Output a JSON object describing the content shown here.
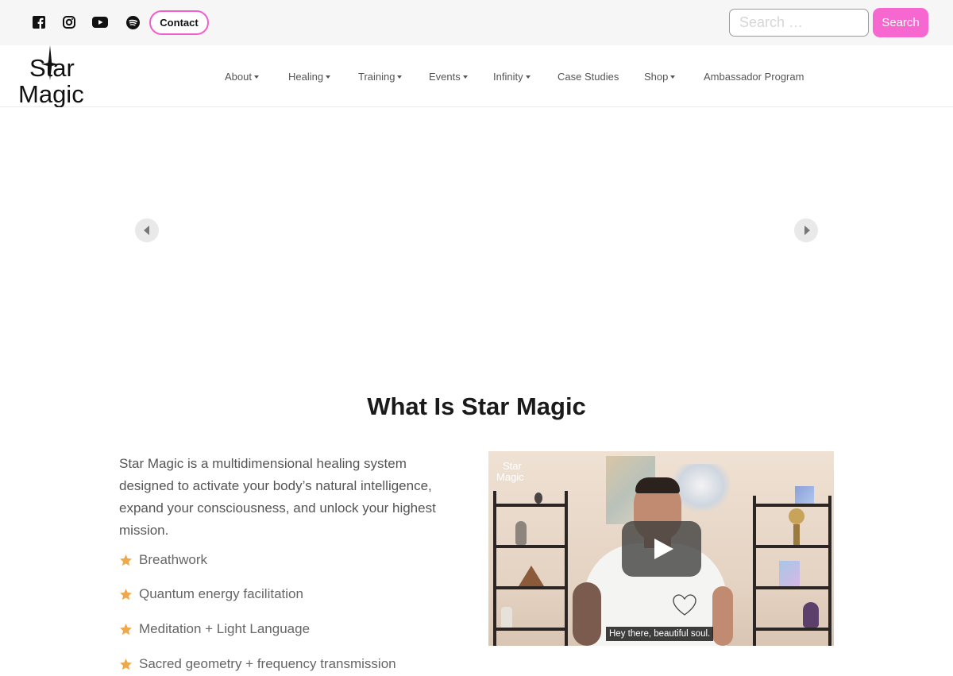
{
  "topbar": {
    "social": [
      {
        "name": "facebook-icon"
      },
      {
        "name": "instagram-icon"
      },
      {
        "name": "youtube-icon"
      },
      {
        "name": "spotify-icon"
      }
    ],
    "contact_label": "Contact",
    "search": {
      "placeholder": "Search …",
      "button_label": "Search"
    }
  },
  "brand": {
    "line1": "Star",
    "line2": "Magic"
  },
  "nav": [
    {
      "label": "About",
      "dropdown": true
    },
    {
      "label": "Healing",
      "dropdown": true
    },
    {
      "label": "Training",
      "dropdown": true
    },
    {
      "label": "Events",
      "dropdown": true
    },
    {
      "label": "Infinity",
      "dropdown": true
    },
    {
      "label": "Case Studies",
      "dropdown": false
    },
    {
      "label": "Shop",
      "dropdown": true
    },
    {
      "label": "Ambassador Program",
      "dropdown": false
    }
  ],
  "section": {
    "title": "What Is Star Magic",
    "intro": "Star Magic is a multidimensional healing system designed to activate your body’s natural intelligence, expand your consciousness, and unlock your highest mission.",
    "features": [
      "Breathwork",
      "Quantum energy facilitation",
      "Meditation + Light Language",
      "Sacred geometry + frequency transmission"
    ]
  },
  "video": {
    "logo_line1": "Star",
    "logo_line2": "Magic",
    "caption": "Hey there, beautiful soul."
  },
  "colors": {
    "accent_pink": "#f767d0",
    "contact_border": "#f05fcb",
    "star_gold": "#f0a94a",
    "topbar_bg": "#f6f6f6"
  }
}
